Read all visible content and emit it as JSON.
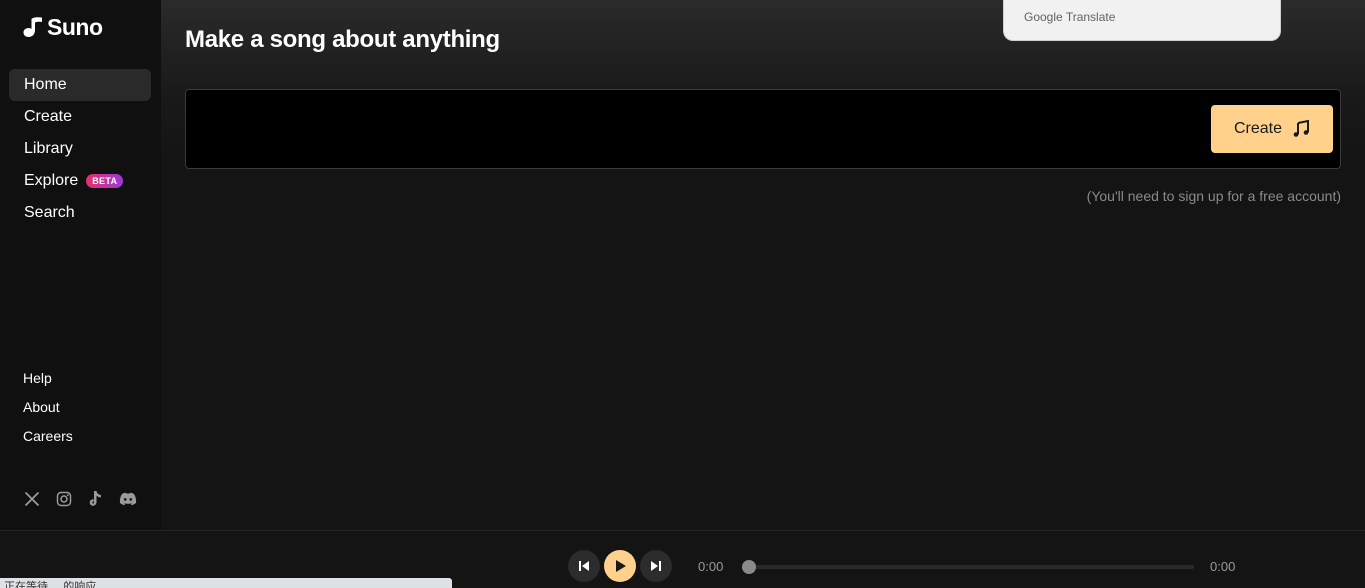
{
  "brand": {
    "name": "Suno"
  },
  "sidebar": {
    "nav": [
      {
        "label": "Home",
        "active": true
      },
      {
        "label": "Create"
      },
      {
        "label": "Library"
      },
      {
        "label": "Explore",
        "badge": "BETA"
      },
      {
        "label": "Search"
      }
    ],
    "footer": [
      {
        "label": "Help"
      },
      {
        "label": "About"
      },
      {
        "label": "Careers"
      }
    ],
    "socials": [
      "x-icon",
      "instagram-icon",
      "tiktok-icon",
      "discord-icon"
    ]
  },
  "main": {
    "title": "Make a song about anything",
    "prompt": {
      "value": "",
      "placeholder": ""
    },
    "create_label": "Create",
    "signup_note": "(You'll need to sign up for a free account)"
  },
  "translate_popup": {
    "google": "Google",
    "translate": "Translate"
  },
  "player": {
    "current_time": "0:00",
    "total_time": "0:00",
    "progress": 0
  },
  "status_bar": {
    "text": "正在等待 ... 的响应"
  },
  "colors": {
    "accent": "#ffd18a",
    "background": "#141414",
    "sidebar": "#101010",
    "beta_gradient_start": "#e5306e",
    "beta_gradient_end": "#9b3ad6"
  }
}
